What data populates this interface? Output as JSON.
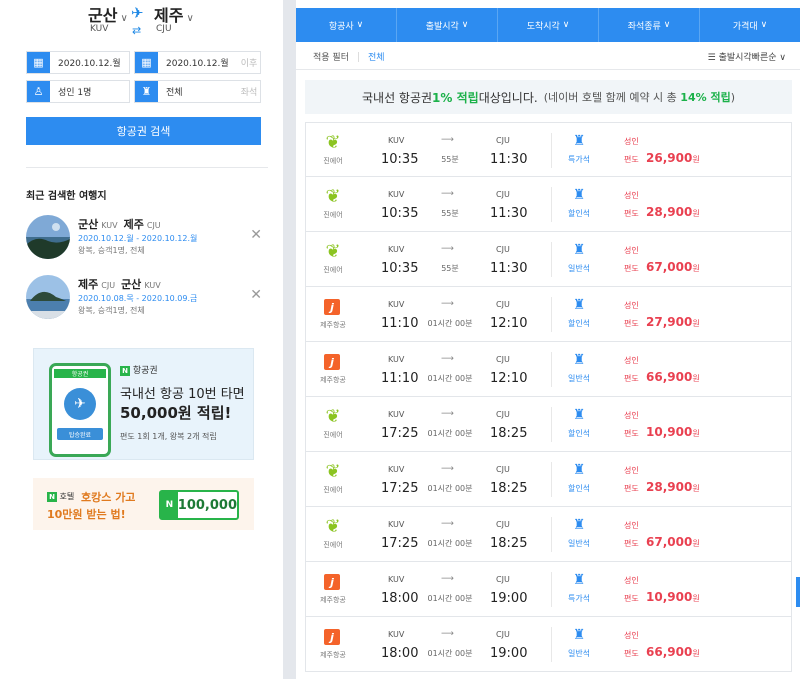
{
  "search": {
    "origin": "군산",
    "origin_code": "KUV",
    "dest": "제주",
    "dest_code": "CJU",
    "depart_date": "2020.10.12.월",
    "return_date": "2020.10.12.월",
    "return_suffix": "이후",
    "passengers": "성인 1명",
    "seat_class": "전체",
    "seat_suffix": "좌석",
    "search_button": "항공권 검색"
  },
  "recent": {
    "title": "최근 검색한 여행지",
    "items": [
      {
        "from": "군산",
        "from_code": "KUV",
        "to": "제주",
        "to_code": "CJU",
        "date": "2020.10.12.월 - 2020.10.12.월",
        "info": "왕복, 승객1명, 전체"
      },
      {
        "from": "제주",
        "from_code": "CJU",
        "to": "군산",
        "to_code": "KUV",
        "date": "2020.10.08.목 - 2020.10.09.금",
        "info": "왕복, 승객1명, 전체"
      }
    ]
  },
  "banner1": {
    "phone_header": "항공권",
    "phone_pill": "탑승완료",
    "brand_badge": "N",
    "brand": "항공권",
    "line1": "국내선 항공 10번 타면",
    "line2": "50,000원 적립!",
    "line3": "편도 1회 1개, 왕복 2개 적립"
  },
  "banner2": {
    "brand_badge": "N",
    "brand": "호텔",
    "line1": "호캉스 가고",
    "line2": "10만원 받는 법!",
    "pill_badge": "N",
    "amount": "100,000"
  },
  "filters": {
    "tabs": [
      "항공사",
      "출발시각",
      "도착시각",
      "좌석종류",
      "가격대"
    ],
    "applied_label": "적용 필터",
    "applied_value": "전체",
    "sort": "출발시각빠른순"
  },
  "promo": {
    "prefix": "국내선 항공권 ",
    "highlight": "1% 적립",
    "middle": " 대상입니다. ",
    "sub": "(네이버 호텔 함께 예약 시 총 ",
    "sub_highlight": "14% 적립",
    "sub_end": ")"
  },
  "flights": [
    {
      "airline": "진에어",
      "logo": "jin",
      "dep_code": "KUV",
      "dep": "10:35",
      "dur": "55분",
      "arr_code": "CJU",
      "arr": "11:30",
      "seat": "특가석",
      "pax": "성인",
      "way": "편도",
      "price": "26,900",
      "won": "원"
    },
    {
      "airline": "진에어",
      "logo": "jin",
      "dep_code": "KUV",
      "dep": "10:35",
      "dur": "55분",
      "arr_code": "CJU",
      "arr": "11:30",
      "seat": "할인석",
      "pax": "성인",
      "way": "편도",
      "price": "28,900",
      "won": "원"
    },
    {
      "airline": "진에어",
      "logo": "jin",
      "dep_code": "KUV",
      "dep": "10:35",
      "dur": "55분",
      "arr_code": "CJU",
      "arr": "11:30",
      "seat": "일반석",
      "pax": "성인",
      "way": "편도",
      "price": "67,000",
      "won": "원"
    },
    {
      "airline": "제주항공",
      "logo": "jeju",
      "dep_code": "KUV",
      "dep": "11:10",
      "dur": "01시간 00분",
      "arr_code": "CJU",
      "arr": "12:10",
      "seat": "할인석",
      "pax": "성인",
      "way": "편도",
      "price": "27,900",
      "won": "원"
    },
    {
      "airline": "제주항공",
      "logo": "jeju",
      "dep_code": "KUV",
      "dep": "11:10",
      "dur": "01시간 00분",
      "arr_code": "CJU",
      "arr": "12:10",
      "seat": "일반석",
      "pax": "성인",
      "way": "편도",
      "price": "66,900",
      "won": "원"
    },
    {
      "airline": "진에어",
      "logo": "jin",
      "dep_code": "KUV",
      "dep": "17:25",
      "dur": "01시간 00분",
      "arr_code": "CJU",
      "arr": "18:25",
      "seat": "할인석",
      "pax": "성인",
      "way": "편도",
      "price": "10,900",
      "won": "원"
    },
    {
      "airline": "진에어",
      "logo": "jin",
      "dep_code": "KUV",
      "dep": "17:25",
      "dur": "01시간 00분",
      "arr_code": "CJU",
      "arr": "18:25",
      "seat": "할인석",
      "pax": "성인",
      "way": "편도",
      "price": "28,900",
      "won": "원"
    },
    {
      "airline": "진에어",
      "logo": "jin",
      "dep_code": "KUV",
      "dep": "17:25",
      "dur": "01시간 00분",
      "arr_code": "CJU",
      "arr": "18:25",
      "seat": "일반석",
      "pax": "성인",
      "way": "편도",
      "price": "67,000",
      "won": "원"
    },
    {
      "airline": "제주항공",
      "logo": "jeju",
      "dep_code": "KUV",
      "dep": "18:00",
      "dur": "01시간 00분",
      "arr_code": "CJU",
      "arr": "19:00",
      "seat": "특가석",
      "pax": "성인",
      "way": "편도",
      "price": "10,900",
      "won": "원"
    },
    {
      "airline": "제주항공",
      "logo": "jeju",
      "dep_code": "KUV",
      "dep": "18:00",
      "dur": "01시간 00분",
      "arr_code": "CJU",
      "arr": "19:00",
      "seat": "일반석",
      "pax": "성인",
      "way": "편도",
      "price": "66,900",
      "won": "원"
    }
  ]
}
